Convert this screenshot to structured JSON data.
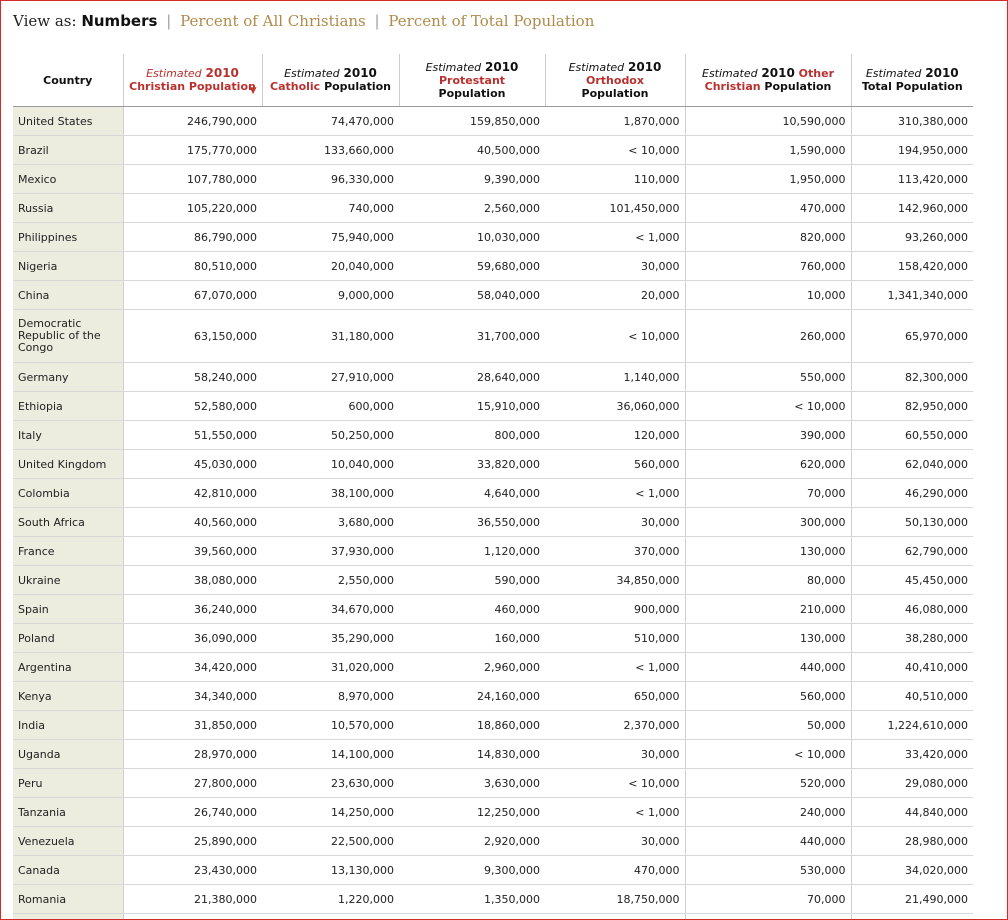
{
  "view": {
    "label": "View as:",
    "current": "Numbers",
    "separator": "|",
    "options": [
      "Percent of All Christians",
      "Percent of Total Population"
    ]
  },
  "headers": {
    "country": "Country",
    "christian": {
      "est": "Estimated",
      "year": "2010",
      "name": "Christian Population"
    },
    "catholic": {
      "est": "Estimated",
      "year": "2010",
      "name": "Catholic",
      "suffix": "Population"
    },
    "protestant": {
      "est": "Estimated",
      "year": "2010",
      "name": "Protestant",
      "suffix": "Population"
    },
    "orthodox": {
      "est": "Estimated",
      "year": "2010",
      "name": "Orthodox",
      "suffix": "Population"
    },
    "other": {
      "est": "Estimated",
      "year": "2010",
      "name": "Other Christian",
      "suffix": "Population"
    },
    "total": {
      "est": "Estimated",
      "year": "2010",
      "name": "Total Population"
    },
    "sort_indicator": "▼"
  },
  "rows": [
    {
      "country": "United States",
      "christian": "246,790,000",
      "catholic": "74,470,000",
      "protestant": "159,850,000",
      "orthodox": "1,870,000",
      "other": "10,590,000",
      "total": "310,380,000"
    },
    {
      "country": "Brazil",
      "christian": "175,770,000",
      "catholic": "133,660,000",
      "protestant": "40,500,000",
      "orthodox": "< 10,000",
      "other": "1,590,000",
      "total": "194,950,000"
    },
    {
      "country": "Mexico",
      "christian": "107,780,000",
      "catholic": "96,330,000",
      "protestant": "9,390,000",
      "orthodox": "110,000",
      "other": "1,950,000",
      "total": "113,420,000"
    },
    {
      "country": "Russia",
      "christian": "105,220,000",
      "catholic": "740,000",
      "protestant": "2,560,000",
      "orthodox": "101,450,000",
      "other": "470,000",
      "total": "142,960,000"
    },
    {
      "country": "Philippines",
      "christian": "86,790,000",
      "catholic": "75,940,000",
      "protestant": "10,030,000",
      "orthodox": "< 1,000",
      "other": "820,000",
      "total": "93,260,000"
    },
    {
      "country": "Nigeria",
      "christian": "80,510,000",
      "catholic": "20,040,000",
      "protestant": "59,680,000",
      "orthodox": "30,000",
      "other": "760,000",
      "total": "158,420,000"
    },
    {
      "country": "China",
      "christian": "67,070,000",
      "catholic": "9,000,000",
      "protestant": "58,040,000",
      "orthodox": "20,000",
      "other": "10,000",
      "total": "1,341,340,000"
    },
    {
      "country": "Democratic Republic of the Congo",
      "christian": "63,150,000",
      "catholic": "31,180,000",
      "protestant": "31,700,000",
      "orthodox": "< 10,000",
      "other": "260,000",
      "total": "65,970,000"
    },
    {
      "country": "Germany",
      "christian": "58,240,000",
      "catholic": "27,910,000",
      "protestant": "28,640,000",
      "orthodox": "1,140,000",
      "other": "550,000",
      "total": "82,300,000"
    },
    {
      "country": "Ethiopia",
      "christian": "52,580,000",
      "catholic": "600,000",
      "protestant": "15,910,000",
      "orthodox": "36,060,000",
      "other": "< 10,000",
      "total": "82,950,000"
    },
    {
      "country": "Italy",
      "christian": "51,550,000",
      "catholic": "50,250,000",
      "protestant": "800,000",
      "orthodox": "120,000",
      "other": "390,000",
      "total": "60,550,000"
    },
    {
      "country": "United Kingdom",
      "christian": "45,030,000",
      "catholic": "10,040,000",
      "protestant": "33,820,000",
      "orthodox": "560,000",
      "other": "620,000",
      "total": "62,040,000"
    },
    {
      "country": "Colombia",
      "christian": "42,810,000",
      "catholic": "38,100,000",
      "protestant": "4,640,000",
      "orthodox": "< 1,000",
      "other": "70,000",
      "total": "46,290,000"
    },
    {
      "country": "South Africa",
      "christian": "40,560,000",
      "catholic": "3,680,000",
      "protestant": "36,550,000",
      "orthodox": "30,000",
      "other": "300,000",
      "total": "50,130,000"
    },
    {
      "country": "France",
      "christian": "39,560,000",
      "catholic": "37,930,000",
      "protestant": "1,120,000",
      "orthodox": "370,000",
      "other": "130,000",
      "total": "62,790,000"
    },
    {
      "country": "Ukraine",
      "christian": "38,080,000",
      "catholic": "2,550,000",
      "protestant": "590,000",
      "orthodox": "34,850,000",
      "other": "80,000",
      "total": "45,450,000"
    },
    {
      "country": "Spain",
      "christian": "36,240,000",
      "catholic": "34,670,000",
      "protestant": "460,000",
      "orthodox": "900,000",
      "other": "210,000",
      "total": "46,080,000"
    },
    {
      "country": "Poland",
      "christian": "36,090,000",
      "catholic": "35,290,000",
      "protestant": "160,000",
      "orthodox": "510,000",
      "other": "130,000",
      "total": "38,280,000"
    },
    {
      "country": "Argentina",
      "christian": "34,420,000",
      "catholic": "31,020,000",
      "protestant": "2,960,000",
      "orthodox": "< 1,000",
      "other": "440,000",
      "total": "40,410,000"
    },
    {
      "country": "Kenya",
      "christian": "34,340,000",
      "catholic": "8,970,000",
      "protestant": "24,160,000",
      "orthodox": "650,000",
      "other": "560,000",
      "total": "40,510,000"
    },
    {
      "country": "India",
      "christian": "31,850,000",
      "catholic": "10,570,000",
      "protestant": "18,860,000",
      "orthodox": "2,370,000",
      "other": "50,000",
      "total": "1,224,610,000"
    },
    {
      "country": "Uganda",
      "christian": "28,970,000",
      "catholic": "14,100,000",
      "protestant": "14,830,000",
      "orthodox": "30,000",
      "other": "< 10,000",
      "total": "33,420,000"
    },
    {
      "country": "Peru",
      "christian": "27,800,000",
      "catholic": "23,630,000",
      "protestant": "3,630,000",
      "orthodox": "< 10,000",
      "other": "520,000",
      "total": "29,080,000"
    },
    {
      "country": "Tanzania",
      "christian": "26,740,000",
      "catholic": "14,250,000",
      "protestant": "12,250,000",
      "orthodox": "< 1,000",
      "other": "240,000",
      "total": "44,840,000"
    },
    {
      "country": "Venezuela",
      "christian": "25,890,000",
      "catholic": "22,500,000",
      "protestant": "2,920,000",
      "orthodox": "30,000",
      "other": "440,000",
      "total": "28,980,000"
    },
    {
      "country": "Canada",
      "christian": "23,430,000",
      "catholic": "13,130,000",
      "protestant": "9,300,000",
      "orthodox": "470,000",
      "other": "530,000",
      "total": "34,020,000"
    },
    {
      "country": "Romania",
      "christian": "21,380,000",
      "catholic": "1,220,000",
      "protestant": "1,350,000",
      "orthodox": "18,750,000",
      "other": "70,000",
      "total": "21,490,000"
    }
  ]
}
